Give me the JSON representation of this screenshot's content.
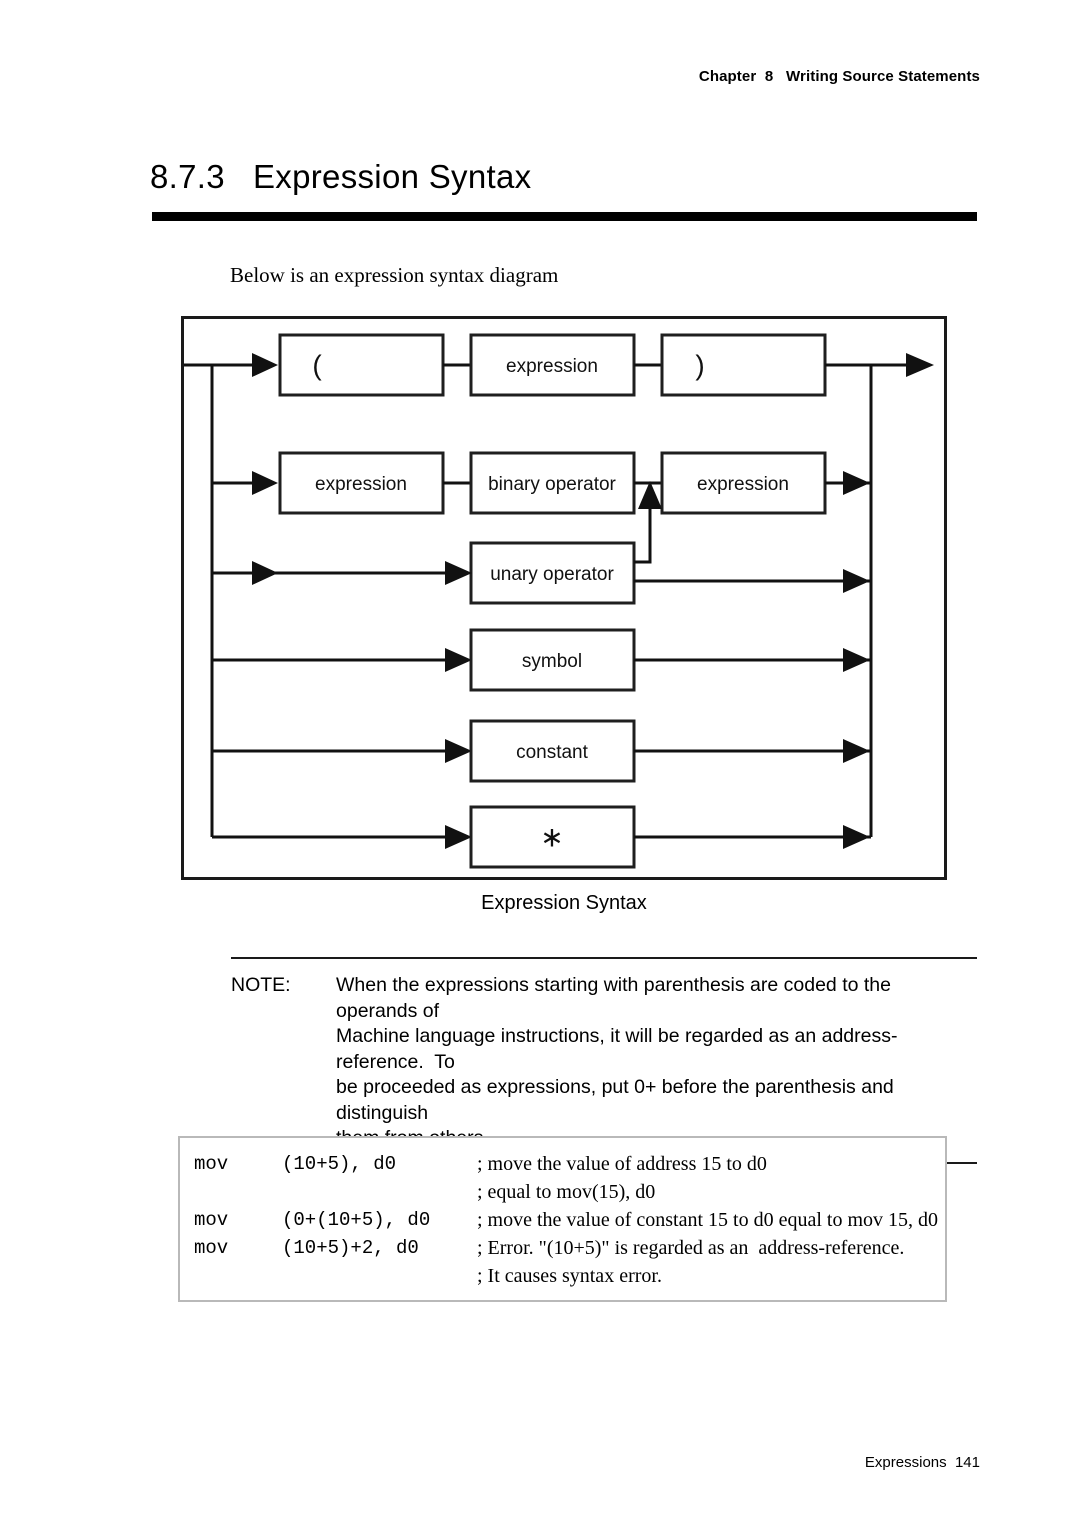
{
  "page": {
    "running_head": "Chapter  8   Writing Source Statements",
    "footer": "Expressions  141"
  },
  "section": {
    "number": "8.7.3",
    "title": "Expression Syntax"
  },
  "intro": "Below is an expression syntax diagram",
  "diagram": {
    "caption": "Expression Syntax",
    "rows": [
      {
        "id": "paren",
        "boxes": [
          "(",
          "expression",
          ")"
        ]
      },
      {
        "id": "binary",
        "boxes": [
          "expression",
          "binary operator",
          "expression"
        ]
      },
      {
        "id": "unary",
        "boxes": [
          "unary operator"
        ]
      },
      {
        "id": "symbol",
        "boxes": [
          "symbol"
        ]
      },
      {
        "id": "constant",
        "boxes": [
          "constant"
        ]
      },
      {
        "id": "asterisk",
        "boxes": [
          "∗"
        ]
      }
    ],
    "labels": {
      "open_paren": "(",
      "close_paren": ")",
      "expression_1": "expression",
      "expression_2": "expression",
      "expression_3": "expression",
      "binary_operator": "binary operator",
      "unary_operator": "unary operator",
      "symbol": "symbol",
      "constant": "constant",
      "asterisk": "∗"
    }
  },
  "note": {
    "tag": "NOTE:",
    "lines": [
      "When the expressions starting with parenthesis are coded to the operands of",
      "Machine language instructions, it will be regarded as an address-reference.  To",
      "be proceeded as expressions, put 0+ before the parenthesis and distinguish",
      "them from others."
    ]
  },
  "examples": {
    "rows": [
      {
        "mnemonic": "mov",
        "operand": "(10+5), d0",
        "comments": [
          "; move the value of address 15 to d0",
          "; equal to mov(15), d0"
        ]
      },
      {
        "mnemonic": "mov",
        "operand": "(0+(10+5), d0",
        "comments": [
          "; move the value of constant 15 to d0 equal to mov 15, d0"
        ]
      },
      {
        "mnemonic": "mov",
        "operand": "(10+5)+2, d0",
        "comments": [
          "; Error. \"(10+5)\" is regarded as an  address-reference.",
          "; It causes syntax error."
        ]
      }
    ]
  },
  "colors": {
    "ink": "#000000",
    "rule": "#1a1a1a",
    "table_border": "#b9b9b9",
    "page_bg": "#ffffff"
  }
}
